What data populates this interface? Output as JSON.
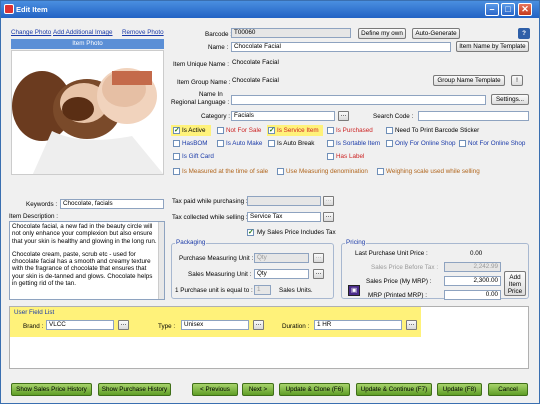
{
  "window": {
    "title": "Edit Item"
  },
  "photo": {
    "change": "Change Photo",
    "add": "Add Additional Image",
    "remove": "Remove Photo",
    "header": "Item Photo"
  },
  "barcode": {
    "label": "Barcode :",
    "value": "T00060",
    "define_btn": "Define my own",
    "auto_btn": "Auto-Generate"
  },
  "name": {
    "label": "Name :",
    "value": "Chocolate Facial",
    "template_btn": "Item Name by Template"
  },
  "unique_name": {
    "label": "Item Unique Name :",
    "value": "Chocolate Facial"
  },
  "group_name": {
    "label": "Item Group Name :",
    "value": "Chocolate Facial",
    "template_btn": "Group Name Template",
    "excl_btn": "!"
  },
  "regional": {
    "label1": "Name In",
    "label2": "Regional Language :",
    "settings_btn": "Settings..."
  },
  "category": {
    "label": "Category :",
    "value": "Facials",
    "search_label": "Search Code :"
  },
  "flags": {
    "is_active": "Is Active",
    "not_for_sale": "Not For Sale",
    "is_service_item": "Is Service Item",
    "is_purchased": "Is Purchased",
    "need_barcode": "Need To Print Barcode Sticker",
    "has_bom": "HasBOM",
    "is_auto_make": "Is Auto Make",
    "is_auto_break": "Is Auto Break",
    "is_sortable": "Is Sortable Item",
    "only_online": "Only For Online Shop",
    "not_online": "Not For Online Shop",
    "is_gift_card": "Is Gift Card",
    "has_label": "Has Label",
    "measured": "Is Measured at the time of sale",
    "use_measuring": "Use Measuring denomination",
    "weighing": "Weighing scale used while selling"
  },
  "keywords": {
    "label": "Keywords :",
    "value": "Chocolate, facials"
  },
  "description": {
    "label": "Item Description :",
    "p1": "Chocolate facial, a new fad in the beauty circle will not only enhance your complexion but also ensure that your skin is healthy and glowing in the long run.",
    "p2": "Chocolate cream, paste, scrub etc - used for chocolate facial has a smooth and creamy texture with the fragrance of chocolate that ensures that your skin is de-tanned and glows. Chocolate helps in getting rid of the tan."
  },
  "tax": {
    "paid_label": "Tax paid while purchasing :",
    "collected_label": "Tax collected while selling :",
    "collected_value": "Service Tax",
    "incl_label": "My Sales Price Includes Tax"
  },
  "packaging": {
    "title": "Packaging",
    "pmu_label": "Purchase Measuring Unit :",
    "pmu_value": "Qty",
    "smu_label": "Sales Measuring Unit :",
    "smu_value": "Qty",
    "eq_label": "1  Purchase unit is equal to :",
    "eq_value": "1",
    "eq_suffix": "Sales Units."
  },
  "pricing": {
    "title": "Pricing",
    "last_label": "Last Purchase  Unit Price :",
    "last_value": "0.00",
    "before_label": "Sales Price Before Tax :",
    "before_value": "2,242.99",
    "mrp_label": "Sales Price (My MRP) :",
    "mrp_value": "2,300.00",
    "printed_label": "MRP (Printed MRP) :",
    "printed_value": "0.00",
    "add_btn": "Add Item Price"
  },
  "user_fields": {
    "title": "User Field List",
    "brand_label": "Brand :",
    "brand_value": "VLCC",
    "type_label": "Type :",
    "type_value": "Unisex",
    "duration_label": "Duration :",
    "duration_value": "1 HR"
  },
  "footer": {
    "sales_history": "Show Sales Price History",
    "purchase_history": "Show Purchase History",
    "previous": "< Previous",
    "next": "Next >",
    "update_clone": "Update & Clone  (F6)",
    "update_continue": "Update & Continue (F7)",
    "update": "Update (F8)",
    "cancel": "Cancel"
  }
}
